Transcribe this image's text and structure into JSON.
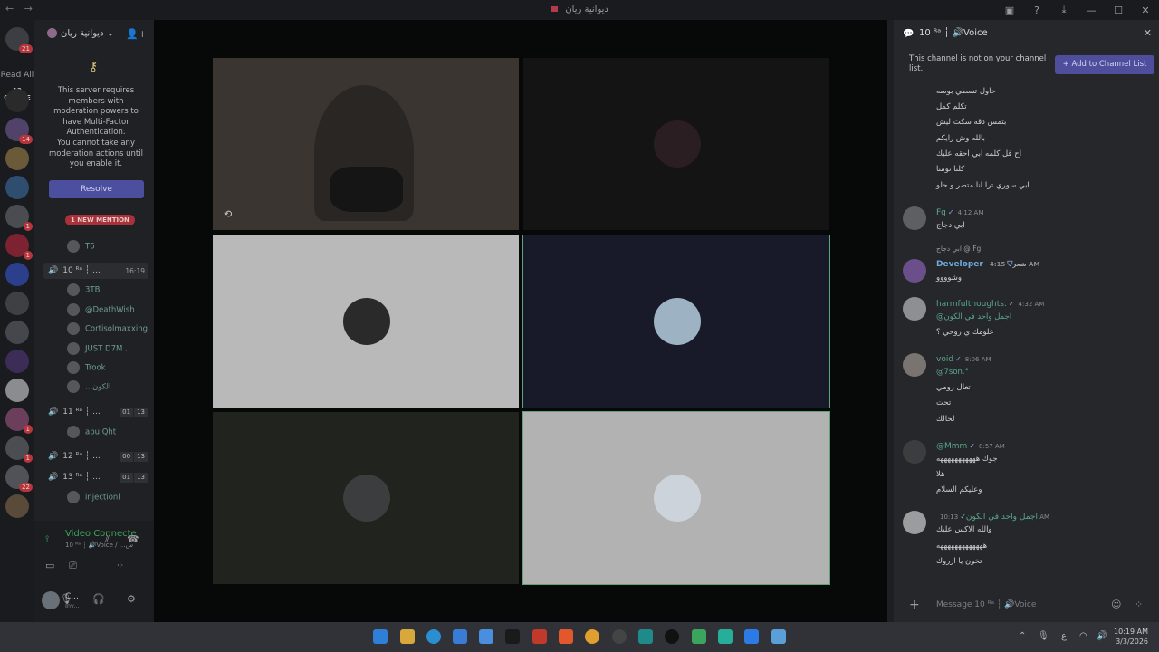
{
  "window": {
    "title": "ديوانية ريان",
    "nav_back": "←",
    "nav_forward": "→"
  },
  "servers": {
    "home_badge": "21",
    "read_all": "Read All",
    "online": "12 ONLINE",
    "badges": [
      "14",
      "1",
      "1",
      "1",
      "1",
      "22"
    ]
  },
  "channels": {
    "server_name": "ديوانية ريان",
    "mfa_text": "This server requires members with moderation powers to have Multi-Factor Authentication.",
    "mfa_text2": "You cannot take any moderation actions until you enable it.",
    "resolve": "Resolve",
    "new_mention": "1 NEW MENTION",
    "user_t6": "T6",
    "voice": [
      {
        "name": "10 ᴿᵃ ┆ ...",
        "time": "16:19"
      },
      {
        "name": "11 ᴿᵃ ┆ ...",
        "a": "01",
        "b": "13"
      },
      {
        "name": "12 ᴿᵃ ┆ ...",
        "a": "00",
        "b": "13"
      },
      {
        "name": "13 ᴿᵃ ┆ ...",
        "a": "01",
        "b": "13"
      }
    ],
    "members_10": [
      "3TB",
      "@DeathWish",
      "Cortisolmaxxing",
      "JUST D7M .",
      "Trook",
      "...الكون"
    ],
    "member_11": "abu Qht",
    "member_13": "injectionl"
  },
  "voice_bar": {
    "status": "Video Connecte",
    "sub": "10 ᴿᵃ ┆ 🔊Voice / ...س",
    "user_name": "C...",
    "user_status": "Inv..."
  },
  "side": {
    "header": "10 ᴿᵃ ┆ 🔊Voice",
    "notice": "This channel is not on your channel list.",
    "add_button": "+ Add to Channel List",
    "top_lines": [
      "حاول تسطي بوسه",
      "تكلم كمل",
      "بتمس دقه سكت ليش",
      "بالله وش رايكم",
      "اح قل كلمه ابي احقه عليك",
      "كلنا تومنا",
      "ابي سوري ترا انا متصر و حلو"
    ],
    "messages": [
      {
        "author": "Fg",
        "time": "4:12 AM",
        "lines": [
          "ابي دجاج"
        ]
      },
      {
        "reply": "ابي دجاج @ Fg",
        "author": "Developer",
        "tag": "شعر",
        "time": "4:15 AM",
        "lines": [
          "وشوووو"
        ]
      },
      {
        "author": "harmfulthoughts.",
        "time": "4:32 AM",
        "lines": [
          "@اجمل واحد في الكون",
          "علومك ي روحي ؟"
        ]
      },
      {
        "author": "void",
        "time": "8:06 AM",
        "lines": [
          "@7son.°",
          "تعال زومي",
          "تحت",
          "لحالك"
        ]
      },
      {
        "author": "@Mmm",
        "time": "8:57 AM",
        "lines": [
          "جوك هههههههههههه",
          "هلا",
          "وعليكم السلام"
        ]
      },
      {
        "author": "اجمل واحد في الكون",
        "time": "10:13 AM",
        "lines": [
          "والله الاكس عليك",
          "هههههههههههههه",
          "تخون يا ازروك"
        ]
      }
    ],
    "composer_placeholder": "Message 10 ᴿᵃ ┆ 🔊Voice"
  },
  "taskbar": {
    "time": "10:19 AM",
    "date": "3/3/2026",
    "lang": "ع"
  },
  "colors": {
    "accent": "#4e4e9c",
    "connected": "#3ba55d",
    "mention": "#a8313a",
    "tile_selected_border": "#5fa37c"
  }
}
